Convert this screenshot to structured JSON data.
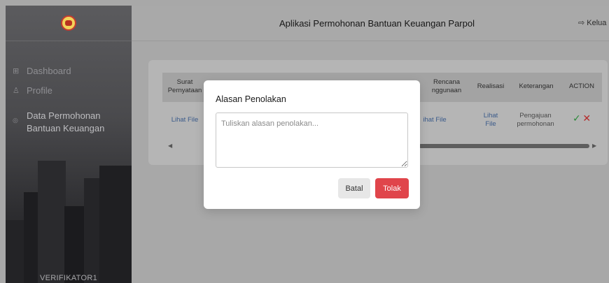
{
  "sidebar": {
    "items": [
      {
        "icon": "grid-icon",
        "label": "Dashboard"
      },
      {
        "icon": "user-icon",
        "label": "Profile"
      },
      {
        "icon": "coin-icon",
        "label_lines": [
          "Data Permohonan",
          "Bantuan Keuangan"
        ]
      }
    ],
    "user_label": "VERIFIKATOR1"
  },
  "header": {
    "title": "Aplikasi Permohonan Bantuan Keuangan Parpol",
    "logout_label": "Kelua",
    "logout_icon": "logout-icon"
  },
  "table": {
    "headers": {
      "surat_pernyataan": [
        "Surat",
        "Pernyataan"
      ],
      "rencana_penggunaan": [
        "Rencana",
        "nggunaan"
      ],
      "realisasi": "Realisasi",
      "keterangan": "Keterangan",
      "action": "ACTION"
    },
    "row": {
      "surat_pernyataan": "Lihat File",
      "rencana_penggunaan": "ihat File",
      "realisasi": [
        "Lihat",
        "File"
      ],
      "keterangan": [
        "Pengajuan",
        "permohonan"
      ],
      "approve_icon": "check-icon",
      "reject_icon": "close-icon"
    }
  },
  "modal": {
    "title": "Alasan Penolakan",
    "textarea_placeholder": "Tuliskan alasan penolakan...",
    "textarea_value": "",
    "cancel_label": "Batal",
    "reject_label": "Tolak"
  },
  "colors": {
    "reject_button": "#e0454b",
    "approve_icon": "#2d8a3a",
    "reject_icon": "#b52a2a",
    "link": "#3a5a8a"
  }
}
